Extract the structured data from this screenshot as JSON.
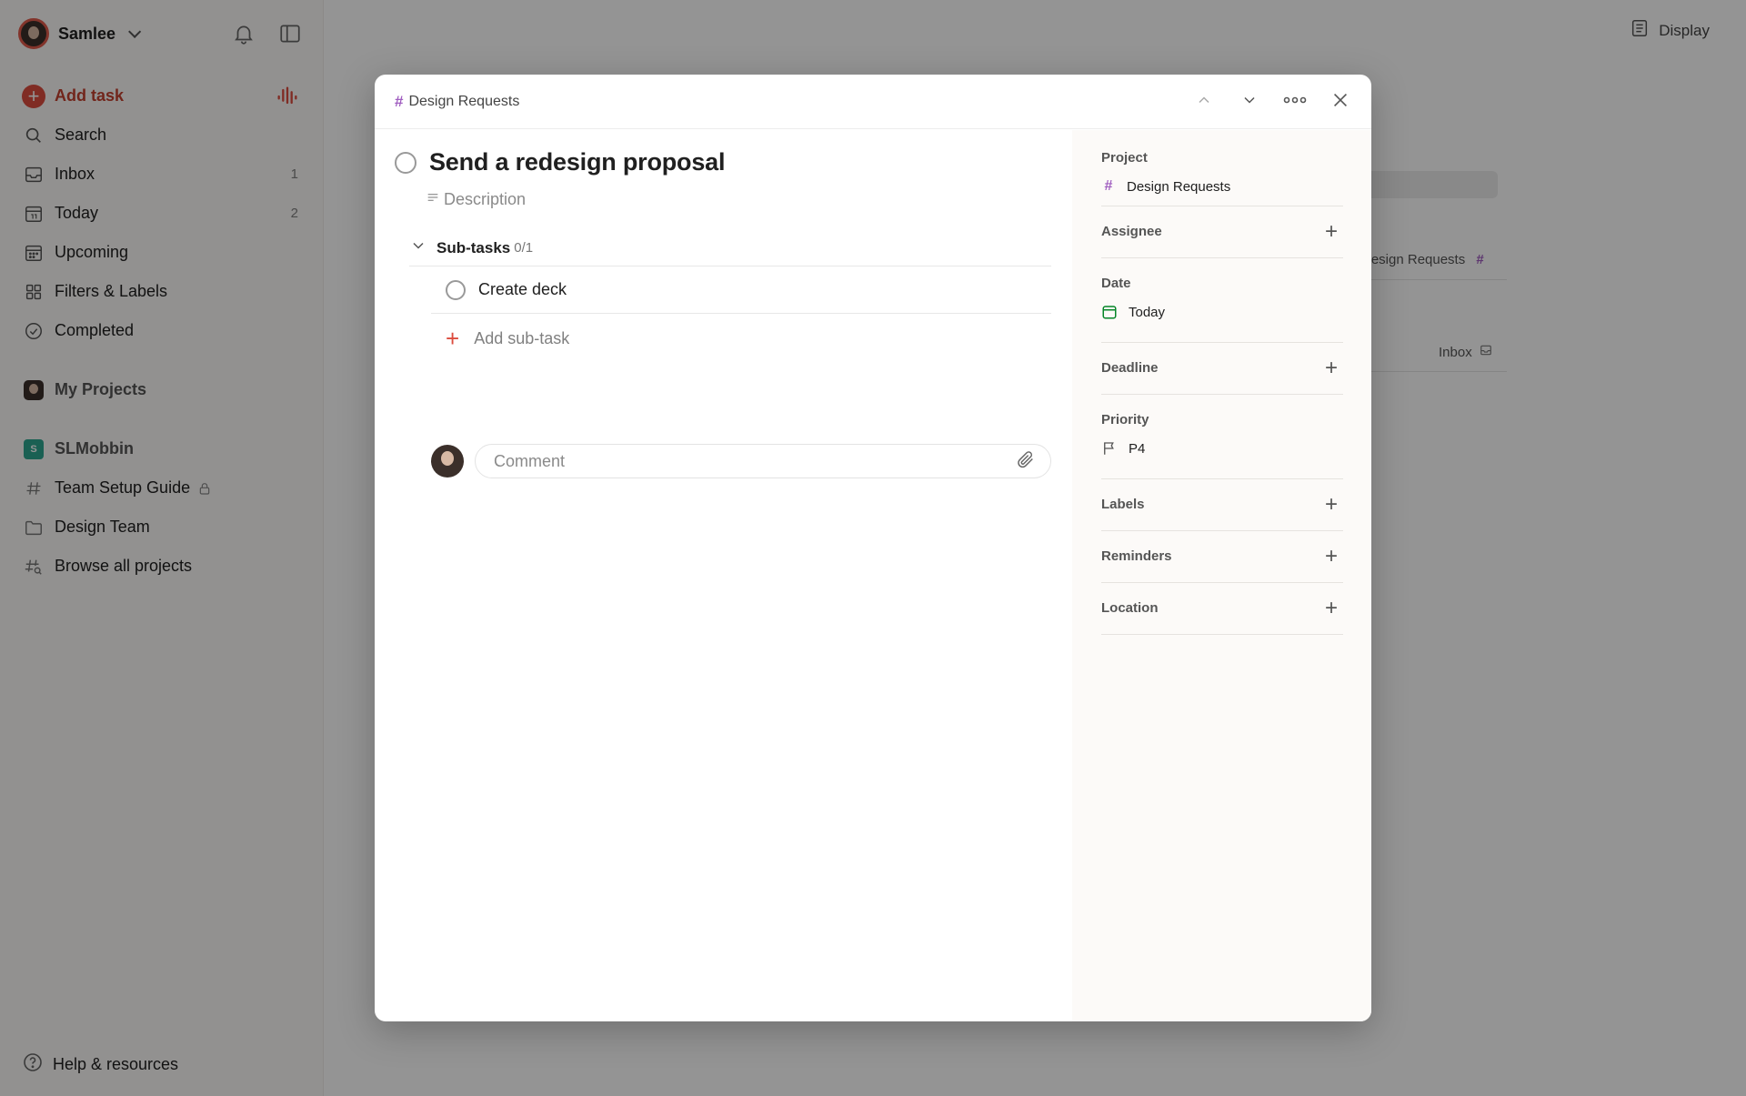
{
  "sidebar": {
    "user_name": "Samlee",
    "nav": {
      "add_task": "Add task",
      "search": "Search",
      "inbox": "Inbox",
      "inbox_count": "1",
      "today": "Today",
      "today_count": "2",
      "upcoming": "Upcoming",
      "filters": "Filters & Labels",
      "completed": "Completed"
    },
    "my_projects": "My Projects",
    "workspace": {
      "badge": "S",
      "name": "SLMobbin",
      "items": [
        "Team Setup Guide",
        "Design Team",
        "Browse all projects"
      ]
    },
    "help": "Help & resources"
  },
  "main": {
    "display_label": "Display",
    "bg_project_ref": "Design Requests",
    "bg_inbox_ref": "Inbox"
  },
  "modal": {
    "breadcrumb": "Design Requests",
    "task_title": "Send a redesign proposal",
    "description_placeholder": "Description",
    "subtasks_label": "Sub-tasks",
    "subtasks_count": "0/1",
    "subtasks": [
      {
        "title": "Create deck"
      }
    ],
    "add_subtask_label": "Add sub-task",
    "comment_placeholder": "Comment"
  },
  "details": {
    "project_label": "Project",
    "project_value": "Design Requests",
    "assignee_label": "Assignee",
    "date_label": "Date",
    "date_value": "Today",
    "deadline_label": "Deadline",
    "priority_label": "Priority",
    "priority_value": "P4",
    "labels_label": "Labels",
    "reminders_label": "Reminders",
    "location_label": "Location"
  },
  "colors": {
    "accent_red": "#dc4c3e",
    "project_purple": "#a05ec0",
    "today_green": "#058527",
    "workspace_teal": "#2ea590"
  }
}
